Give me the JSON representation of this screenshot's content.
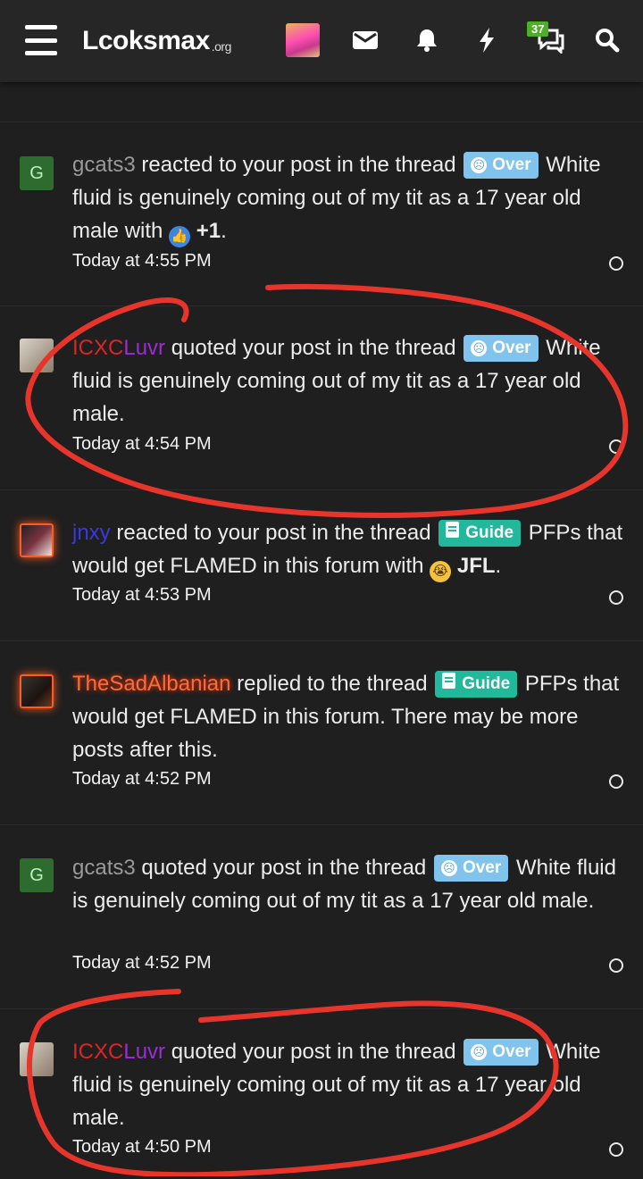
{
  "header": {
    "logo_text": "Lcoksmax",
    "logo_suffix": ".org",
    "conversations_badge": "37",
    "icons": [
      "menu-icon",
      "avatar",
      "mail-icon",
      "bell-icon",
      "lightning-icon",
      "chat-icon",
      "search-icon"
    ]
  },
  "notifications": [
    {
      "user": "gcats3",
      "action": "reacted to your post in the thread",
      "prefix_label": "Over",
      "title": "White fluid is genuinely coming out of my tit as a 17 year old male",
      "reaction_word": "with",
      "reaction_label": "+1",
      "time": "Today at 4:55 PM"
    },
    {
      "user_a": "ICXC",
      "user_b": "Luvr",
      "action": "quoted your post in the thread",
      "prefix_label": "Over",
      "title": "White fluid is genuinely coming out of my tit as a 17 year old male.",
      "time": "Today at 4:54 PM"
    },
    {
      "user": "jnxy",
      "action": "reacted to your post in the thread",
      "prefix_label": "Guide",
      "title": "PFPs that would get FLAMED in this forum",
      "reaction_word": "with",
      "reaction_label": "JFL",
      "time": "Today at 4:53 PM"
    },
    {
      "user": "TheSadAlbanian",
      "action": "replied to the thread",
      "prefix_label": "Guide",
      "title": "PFPs that would get FLAMED in this forum.",
      "suffix": "There may be more posts after this.",
      "time": "Today at 4:52 PM"
    },
    {
      "user": "gcats3",
      "action": "quoted your post in the thread",
      "prefix_label": "Over",
      "title": "White fluid is genuinely coming out of my tit as a 17 year old male.",
      "time": "Today at 4:52 PM"
    },
    {
      "user_a": "ICXC",
      "user_b": "Luvr",
      "action": "quoted your post in the thread",
      "prefix_label": "Over",
      "title": "White fluid is genuinely coming out of my tit as a 17 year old male.",
      "time": "Today at 4:50 PM"
    }
  ],
  "colors": {
    "background": "#1f1f1f",
    "header": "#262626",
    "over_tag": "#80c4ee",
    "guide_tag": "#22b89b",
    "annotation_stroke": "#e8352c"
  }
}
